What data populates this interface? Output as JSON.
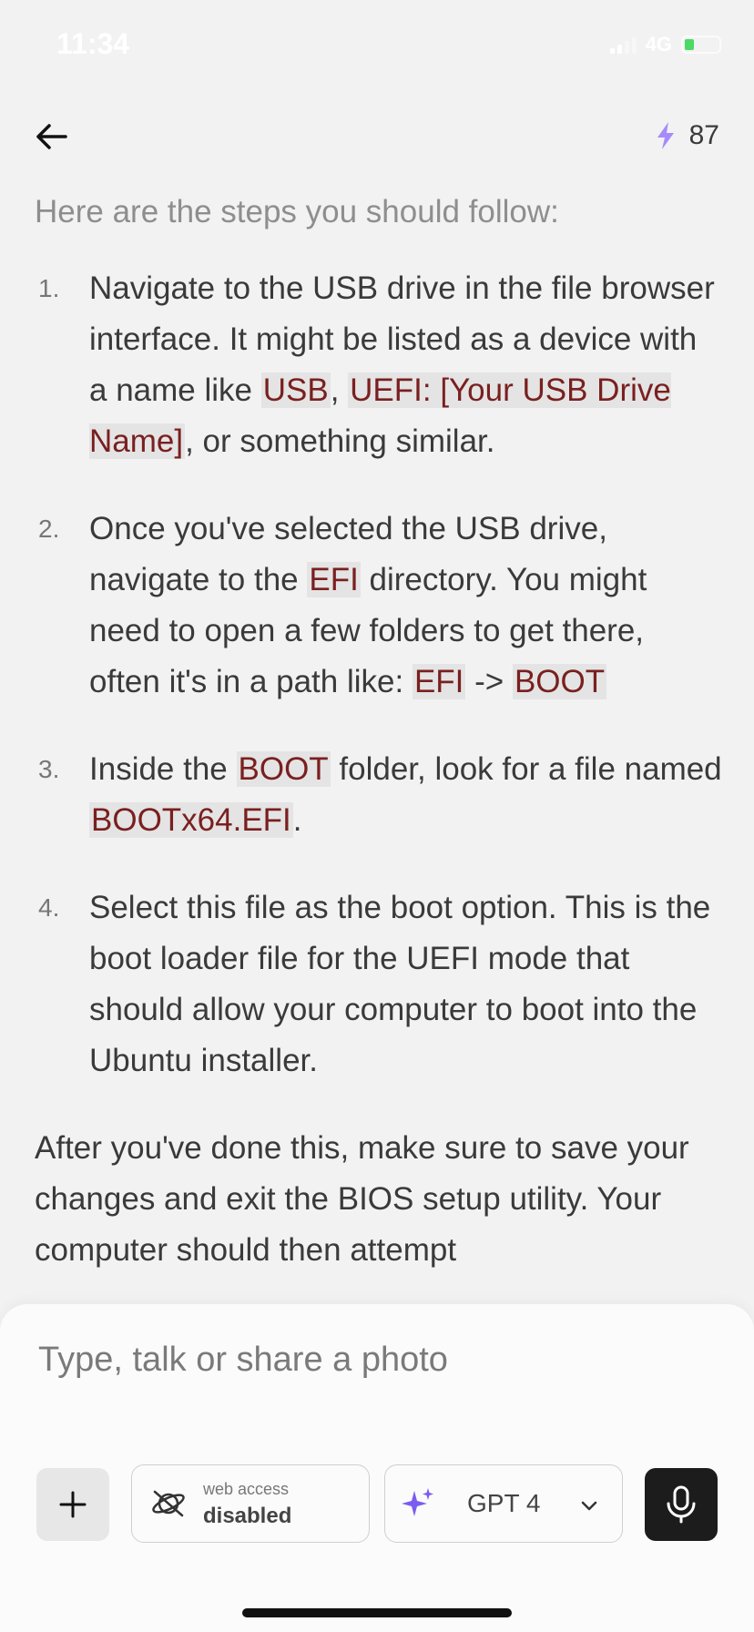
{
  "status_bar": {
    "time": "11:34",
    "network": "4G"
  },
  "header": {
    "credits": "87",
    "accent_color": "#a78bfa"
  },
  "content": {
    "intro": "Here are the steps you should follow:",
    "steps": [
      {
        "number": "1.",
        "parts": [
          {
            "text": "Navigate to the USB drive in the file browser interface. It might be listed as a device with a name like "
          },
          {
            "code": "USB"
          },
          {
            "text": ", "
          },
          {
            "code": "UEFI: [Your USB Drive Name]"
          },
          {
            "text": ", or something similar."
          }
        ]
      },
      {
        "number": "2.",
        "parts": [
          {
            "text": "Once you've selected the USB drive, navigate to the "
          },
          {
            "code": "EFI"
          },
          {
            "text": " directory. You might need to open a few folders to get there, often it's in a path like: "
          },
          {
            "code": "EFI"
          },
          {
            "text": " -> "
          },
          {
            "code": "BOOT"
          }
        ]
      },
      {
        "number": "3.",
        "parts": [
          {
            "text": "Inside the "
          },
          {
            "code": "BOOT"
          },
          {
            "text": " folder, look for a file named "
          },
          {
            "code": "BOOTx64.EFI"
          },
          {
            "text": "."
          }
        ]
      },
      {
        "number": "4.",
        "parts": [
          {
            "text": "Select this file as the boot option. This is the boot loader file for the UEFI mode that should allow your computer to boot into the Ubuntu installer."
          }
        ]
      }
    ],
    "outro": "After you've done this, make sure to save your changes and exit the BIOS setup utility. Your computer should then attempt"
  },
  "composer": {
    "placeholder": "Type, talk or share a photo",
    "web_access_label": "web access",
    "web_access_value": "disabled",
    "model": "GPT 4"
  },
  "icons": {
    "back": "back-arrow-icon",
    "credits": "lightning-icon",
    "add": "plus-icon",
    "web": "planet-slash-icon",
    "model": "sparkle-icon",
    "dropdown": "chevron-down-icon",
    "mic": "microphone-icon"
  }
}
